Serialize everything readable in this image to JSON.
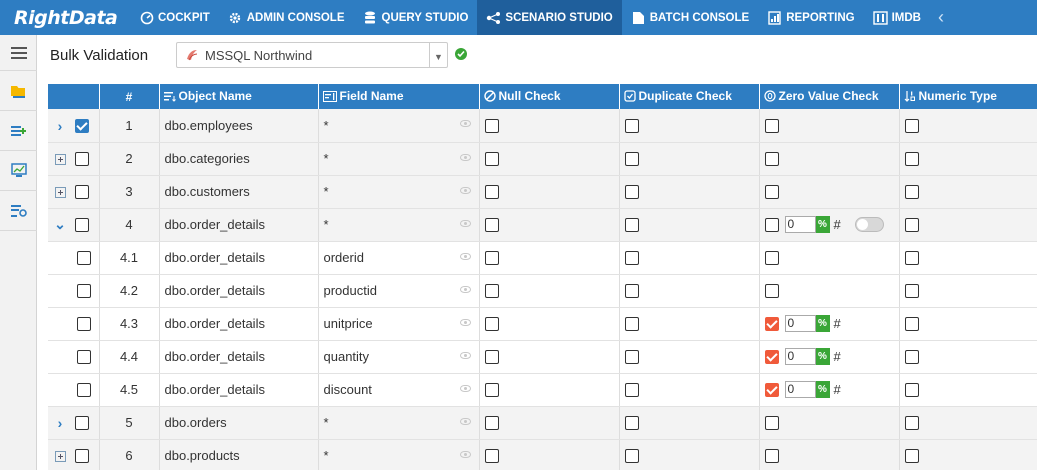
{
  "app": {
    "logo": "RightData"
  },
  "nav": [
    {
      "label": "COCKPIT",
      "icon": "dashboard-icon"
    },
    {
      "label": "ADMIN CONSOLE",
      "icon": "gear-icon"
    },
    {
      "label": "QUERY STUDIO",
      "icon": "database-icon"
    },
    {
      "label": "SCENARIO STUDIO",
      "icon": "scenario-icon",
      "active": true
    },
    {
      "label": "BATCH CONSOLE",
      "icon": "batch-icon"
    },
    {
      "label": "REPORTING",
      "icon": "report-icon"
    },
    {
      "label": "IMDB",
      "icon": "imdb-icon"
    }
  ],
  "page": {
    "title": "Bulk Validation",
    "connection": "MSSQL Northwind"
  },
  "grid": {
    "headers": {
      "num": "#",
      "object": "Object Name",
      "field": "Field Name",
      "null_check": "Null Check",
      "dup_check": "Duplicate Check",
      "zero_check": "Zero Value Check",
      "numeric_type": "Numeric Type"
    },
    "zero_unit": "%",
    "zero_hash": "#",
    "rows": [
      {
        "num": "1",
        "object": "dbo.employees",
        "field": "*"
      },
      {
        "num": "2",
        "object": "dbo.categories",
        "field": "*"
      },
      {
        "num": "3",
        "object": "dbo.customers",
        "field": "*"
      },
      {
        "num": "4",
        "object": "dbo.order_details",
        "field": "*",
        "zero_value": "0"
      },
      {
        "num": "4.1",
        "object": "dbo.order_details",
        "field": "orderid"
      },
      {
        "num": "4.2",
        "object": "dbo.order_details",
        "field": "productid"
      },
      {
        "num": "4.3",
        "object": "dbo.order_details",
        "field": "unitprice",
        "zero_value": "0"
      },
      {
        "num": "4.4",
        "object": "dbo.order_details",
        "field": "quantity",
        "zero_value": "0"
      },
      {
        "num": "4.5",
        "object": "dbo.order_details",
        "field": "discount",
        "zero_value": "0"
      },
      {
        "num": "5",
        "object": "dbo.orders",
        "field": "*"
      },
      {
        "num": "6",
        "object": "dbo.products",
        "field": "*"
      }
    ]
  },
  "colors": {
    "primary": "#2e7dc2",
    "active_nav": "#1f5f9c",
    "checked_red": "#f05a3a",
    "success": "#3aa637"
  }
}
